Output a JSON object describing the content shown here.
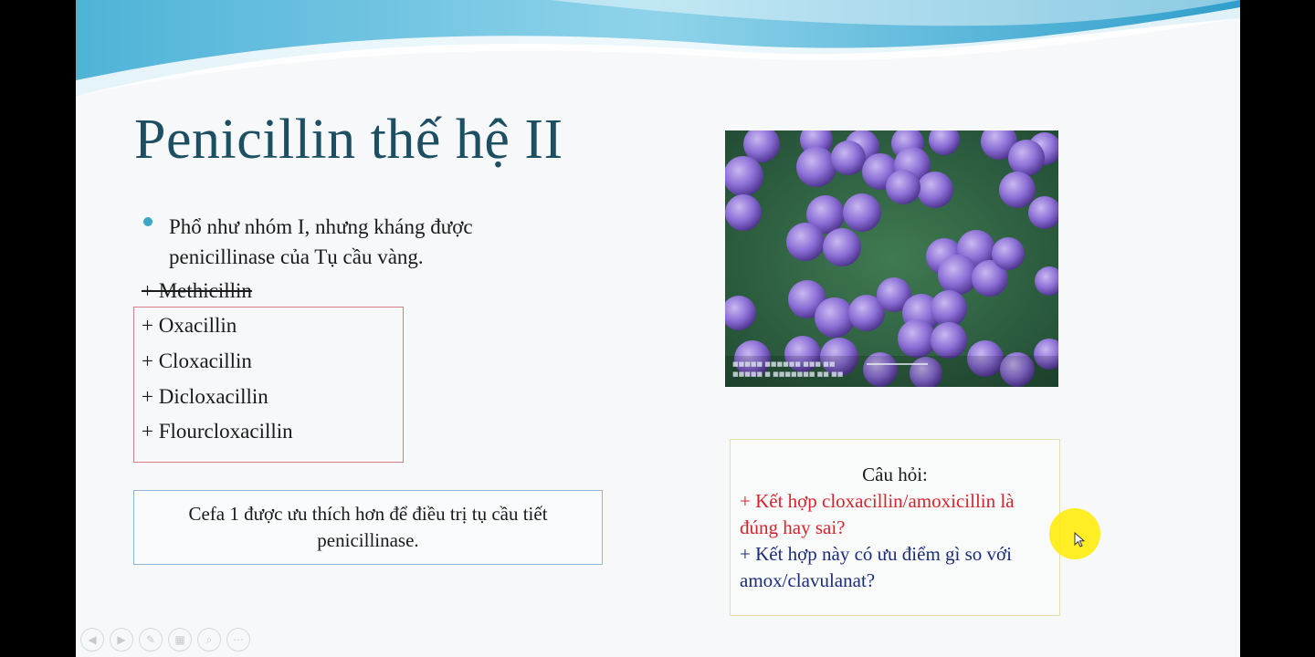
{
  "slide": {
    "title": "Penicillin thế hệ II",
    "bullet_text": "Phổ như nhóm I, nhưng kháng được penicillinase của Tụ cầu vàng.",
    "drugs": {
      "struck": "+ Methicillin",
      "items": [
        "+ Oxacillin",
        "+ Cloxacillin",
        "+ Dicloxacillin",
        "+ Flourcloxacillin"
      ]
    },
    "note": "Cefa 1 được ưu thích hơn để điều trị tụ cầu tiết penicillinase.",
    "question": {
      "title": "Câu hỏi:",
      "red_line": "+ Kết hợp cloxacillin/amoxicillin là đúng hay sai?",
      "blue_line": "+ Kết hợp này có ưu điểm gì so với amox/clavulanat?"
    },
    "image": {
      "subject": "staphylococcus-micrograph"
    },
    "colors": {
      "title": "#1d4f63",
      "bullet": "#3aa7c8",
      "question_red": "#d6242d",
      "question_blue": "#1b2c7a",
      "pointer": "#ffec14"
    }
  },
  "toolbar": {
    "icons": [
      "previous-icon",
      "next-icon",
      "pen-icon",
      "slides-icon",
      "zoom-icon",
      "more-icon"
    ]
  }
}
